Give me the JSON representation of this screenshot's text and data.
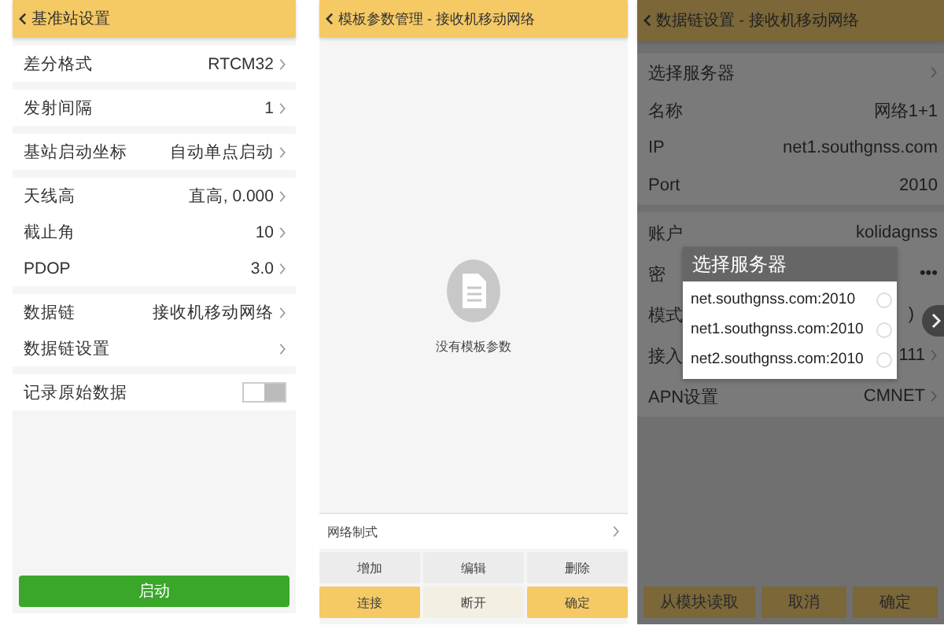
{
  "base_station": {
    "title": "基准站设置",
    "groups": [
      [
        {
          "label": "差分格式",
          "value": "RTCM32",
          "kind": "arrow"
        }
      ],
      [
        {
          "label": "发射间隔",
          "value": "1",
          "kind": "arrow"
        }
      ],
      [
        {
          "label": "基站启动坐标",
          "value": "自动单点启动",
          "kind": "arrow"
        }
      ],
      [
        {
          "label": "天线高",
          "value": "直高, 0.000",
          "kind": "arrow"
        },
        {
          "label": "截止角",
          "value": "10",
          "kind": "arrow"
        },
        {
          "label": "PDOP",
          "value": "3.0",
          "kind": "arrow"
        }
      ],
      [
        {
          "label": "数据链",
          "value": "接收机移动网络",
          "kind": "arrow"
        },
        {
          "label": "数据链设置",
          "kind": "arrow"
        }
      ],
      [
        {
          "label": "记录原始数据",
          "kind": "toggle",
          "on": true
        }
      ]
    ],
    "start_button": "启动"
  },
  "template_manager": {
    "title": "模板参数管理 - 接收机移动网络",
    "empty_text": "没有模板参数",
    "network_row": "网络制式",
    "buttons": [
      {
        "label": "增加",
        "kind": "plain"
      },
      {
        "label": "编辑",
        "kind": "plain"
      },
      {
        "label": "删除",
        "kind": "plain"
      },
      {
        "label": "连接",
        "kind": "primary"
      },
      {
        "label": "断开",
        "kind": "light"
      },
      {
        "label": "确定",
        "kind": "primary"
      }
    ]
  },
  "datalink_settings": {
    "title": "数据链设置 - 接收机移动网络",
    "groups": [
      [
        {
          "label": "选择服务器",
          "arrow": true
        },
        {
          "label": "名称",
          "value": "网络1+1",
          "arrow": false
        },
        {
          "label": "IP",
          "value": "net1.southgnss.com",
          "arrow": false
        },
        {
          "label": "Port",
          "value": "2010",
          "arrow": false
        }
      ],
      [
        {
          "label": "账户",
          "value": "kolidagnss",
          "arrow": false
        },
        {
          "label": "密",
          "value": "•••",
          "arrow": false
        },
        {
          "label": "模式",
          "value": ")",
          "arrow": false
        },
        {
          "label": "接入",
          "value": "111",
          "arrow": true
        },
        {
          "label": "APN设置",
          "value": "CMNET",
          "arrow": true
        }
      ]
    ],
    "buttons": [
      {
        "label": "从模块读取"
      },
      {
        "label": "取消"
      },
      {
        "label": "确定"
      }
    ],
    "dialog": {
      "title": "选择服务器",
      "options": [
        {
          "label": "net.southgnss.com:2010",
          "selected": false
        },
        {
          "label": "net1.southgnss.com:2010",
          "selected": false
        },
        {
          "label": "net2.southgnss.com:2010",
          "selected": false
        }
      ]
    }
  }
}
